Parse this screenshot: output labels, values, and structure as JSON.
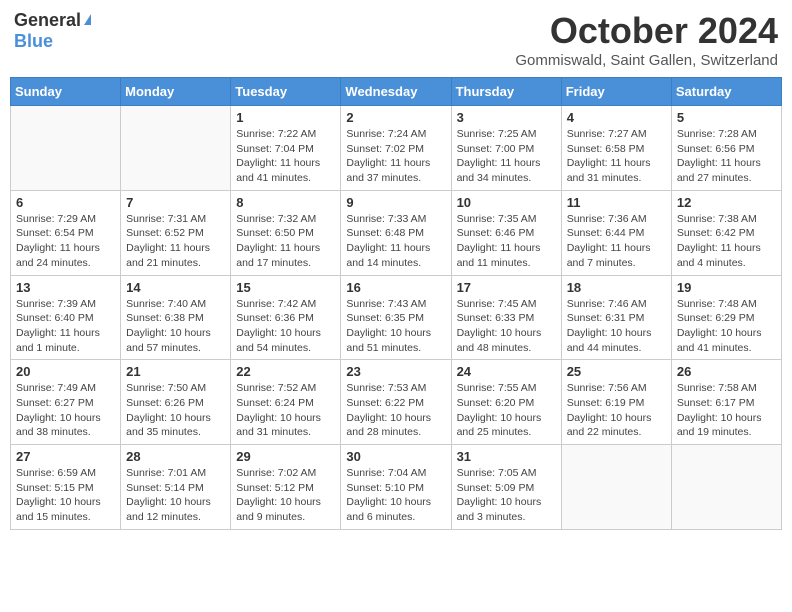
{
  "header": {
    "logo_general": "General",
    "logo_blue": "Blue",
    "month_title": "October 2024",
    "subtitle": "Gommiswald, Saint Gallen, Switzerland"
  },
  "weekdays": [
    "Sunday",
    "Monday",
    "Tuesday",
    "Wednesday",
    "Thursday",
    "Friday",
    "Saturday"
  ],
  "weeks": [
    [
      {
        "day": "",
        "info": ""
      },
      {
        "day": "",
        "info": ""
      },
      {
        "day": "1",
        "info": "Sunrise: 7:22 AM\nSunset: 7:04 PM\nDaylight: 11 hours and 41 minutes."
      },
      {
        "day": "2",
        "info": "Sunrise: 7:24 AM\nSunset: 7:02 PM\nDaylight: 11 hours and 37 minutes."
      },
      {
        "day": "3",
        "info": "Sunrise: 7:25 AM\nSunset: 7:00 PM\nDaylight: 11 hours and 34 minutes."
      },
      {
        "day": "4",
        "info": "Sunrise: 7:27 AM\nSunset: 6:58 PM\nDaylight: 11 hours and 31 minutes."
      },
      {
        "day": "5",
        "info": "Sunrise: 7:28 AM\nSunset: 6:56 PM\nDaylight: 11 hours and 27 minutes."
      }
    ],
    [
      {
        "day": "6",
        "info": "Sunrise: 7:29 AM\nSunset: 6:54 PM\nDaylight: 11 hours and 24 minutes."
      },
      {
        "day": "7",
        "info": "Sunrise: 7:31 AM\nSunset: 6:52 PM\nDaylight: 11 hours and 21 minutes."
      },
      {
        "day": "8",
        "info": "Sunrise: 7:32 AM\nSunset: 6:50 PM\nDaylight: 11 hours and 17 minutes."
      },
      {
        "day": "9",
        "info": "Sunrise: 7:33 AM\nSunset: 6:48 PM\nDaylight: 11 hours and 14 minutes."
      },
      {
        "day": "10",
        "info": "Sunrise: 7:35 AM\nSunset: 6:46 PM\nDaylight: 11 hours and 11 minutes."
      },
      {
        "day": "11",
        "info": "Sunrise: 7:36 AM\nSunset: 6:44 PM\nDaylight: 11 hours and 7 minutes."
      },
      {
        "day": "12",
        "info": "Sunrise: 7:38 AM\nSunset: 6:42 PM\nDaylight: 11 hours and 4 minutes."
      }
    ],
    [
      {
        "day": "13",
        "info": "Sunrise: 7:39 AM\nSunset: 6:40 PM\nDaylight: 11 hours and 1 minute."
      },
      {
        "day": "14",
        "info": "Sunrise: 7:40 AM\nSunset: 6:38 PM\nDaylight: 10 hours and 57 minutes."
      },
      {
        "day": "15",
        "info": "Sunrise: 7:42 AM\nSunset: 6:36 PM\nDaylight: 10 hours and 54 minutes."
      },
      {
        "day": "16",
        "info": "Sunrise: 7:43 AM\nSunset: 6:35 PM\nDaylight: 10 hours and 51 minutes."
      },
      {
        "day": "17",
        "info": "Sunrise: 7:45 AM\nSunset: 6:33 PM\nDaylight: 10 hours and 48 minutes."
      },
      {
        "day": "18",
        "info": "Sunrise: 7:46 AM\nSunset: 6:31 PM\nDaylight: 10 hours and 44 minutes."
      },
      {
        "day": "19",
        "info": "Sunrise: 7:48 AM\nSunset: 6:29 PM\nDaylight: 10 hours and 41 minutes."
      }
    ],
    [
      {
        "day": "20",
        "info": "Sunrise: 7:49 AM\nSunset: 6:27 PM\nDaylight: 10 hours and 38 minutes."
      },
      {
        "day": "21",
        "info": "Sunrise: 7:50 AM\nSunset: 6:26 PM\nDaylight: 10 hours and 35 minutes."
      },
      {
        "day": "22",
        "info": "Sunrise: 7:52 AM\nSunset: 6:24 PM\nDaylight: 10 hours and 31 minutes."
      },
      {
        "day": "23",
        "info": "Sunrise: 7:53 AM\nSunset: 6:22 PM\nDaylight: 10 hours and 28 minutes."
      },
      {
        "day": "24",
        "info": "Sunrise: 7:55 AM\nSunset: 6:20 PM\nDaylight: 10 hours and 25 minutes."
      },
      {
        "day": "25",
        "info": "Sunrise: 7:56 AM\nSunset: 6:19 PM\nDaylight: 10 hours and 22 minutes."
      },
      {
        "day": "26",
        "info": "Sunrise: 7:58 AM\nSunset: 6:17 PM\nDaylight: 10 hours and 19 minutes."
      }
    ],
    [
      {
        "day": "27",
        "info": "Sunrise: 6:59 AM\nSunset: 5:15 PM\nDaylight: 10 hours and 15 minutes."
      },
      {
        "day": "28",
        "info": "Sunrise: 7:01 AM\nSunset: 5:14 PM\nDaylight: 10 hours and 12 minutes."
      },
      {
        "day": "29",
        "info": "Sunrise: 7:02 AM\nSunset: 5:12 PM\nDaylight: 10 hours and 9 minutes."
      },
      {
        "day": "30",
        "info": "Sunrise: 7:04 AM\nSunset: 5:10 PM\nDaylight: 10 hours and 6 minutes."
      },
      {
        "day": "31",
        "info": "Sunrise: 7:05 AM\nSunset: 5:09 PM\nDaylight: 10 hours and 3 minutes."
      },
      {
        "day": "",
        "info": ""
      },
      {
        "day": "",
        "info": ""
      }
    ]
  ]
}
